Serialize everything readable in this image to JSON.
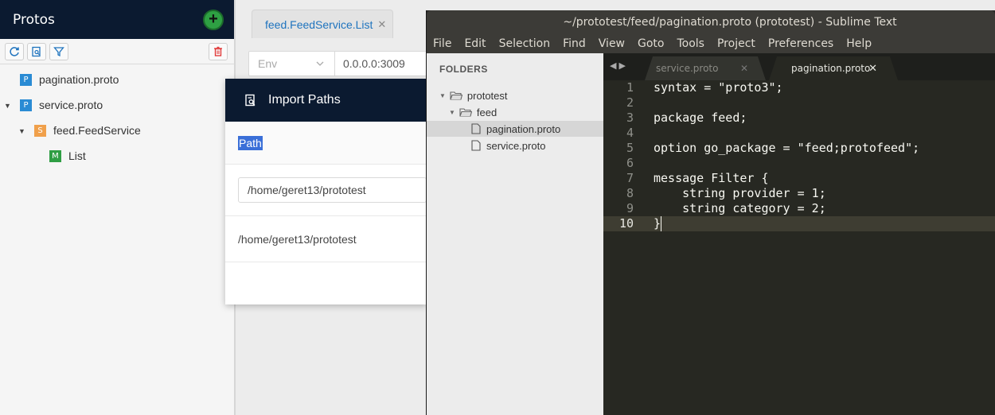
{
  "protos": {
    "title": "Protos",
    "tree": [
      {
        "badge": "P",
        "label": "pagination.proto"
      },
      {
        "badge": "P",
        "label": "service.proto"
      },
      {
        "badge": "S",
        "label": "feed.FeedService"
      },
      {
        "badge": "M",
        "label": "List"
      }
    ]
  },
  "main": {
    "tab_label": "feed.FeedService.List",
    "env_placeholder": "Env",
    "address": "0.0.0.0:3009"
  },
  "modal": {
    "title": "Import Paths",
    "column_header": "Path",
    "input_value": "/home/geret13/prototest",
    "paths": [
      "/home/geret13/prototest"
    ]
  },
  "sublime": {
    "title": "~/prototest/feed/pagination.proto (prototest) - Sublime Text",
    "menu": [
      "File",
      "Edit",
      "Selection",
      "Find",
      "View",
      "Goto",
      "Tools",
      "Project",
      "Preferences",
      "Help"
    ],
    "sidebar": {
      "heading": "FOLDERS",
      "items": [
        "prototest",
        "feed",
        "pagination.proto",
        "service.proto"
      ]
    },
    "tabs": [
      "service.proto",
      "pagination.proto"
    ],
    "code": [
      {
        "n": "1",
        "text": "syntax = \"proto3\";"
      },
      {
        "n": "2",
        "text": ""
      },
      {
        "n": "3",
        "text": "package feed;"
      },
      {
        "n": "4",
        "text": ""
      },
      {
        "n": "5",
        "text": "option go_package = \"feed;protofeed\";"
      },
      {
        "n": "6",
        "text": ""
      },
      {
        "n": "7",
        "text": "message Filter {"
      },
      {
        "n": "8",
        "text": "    string provider = 1;"
      },
      {
        "n": "9",
        "text": "    string category = 2;"
      },
      {
        "n": "10",
        "text": "}"
      }
    ]
  },
  "colors": {
    "header_navy": "#0b1a30",
    "accent_blue": "#1e73be",
    "editor_bg": "#272822"
  }
}
